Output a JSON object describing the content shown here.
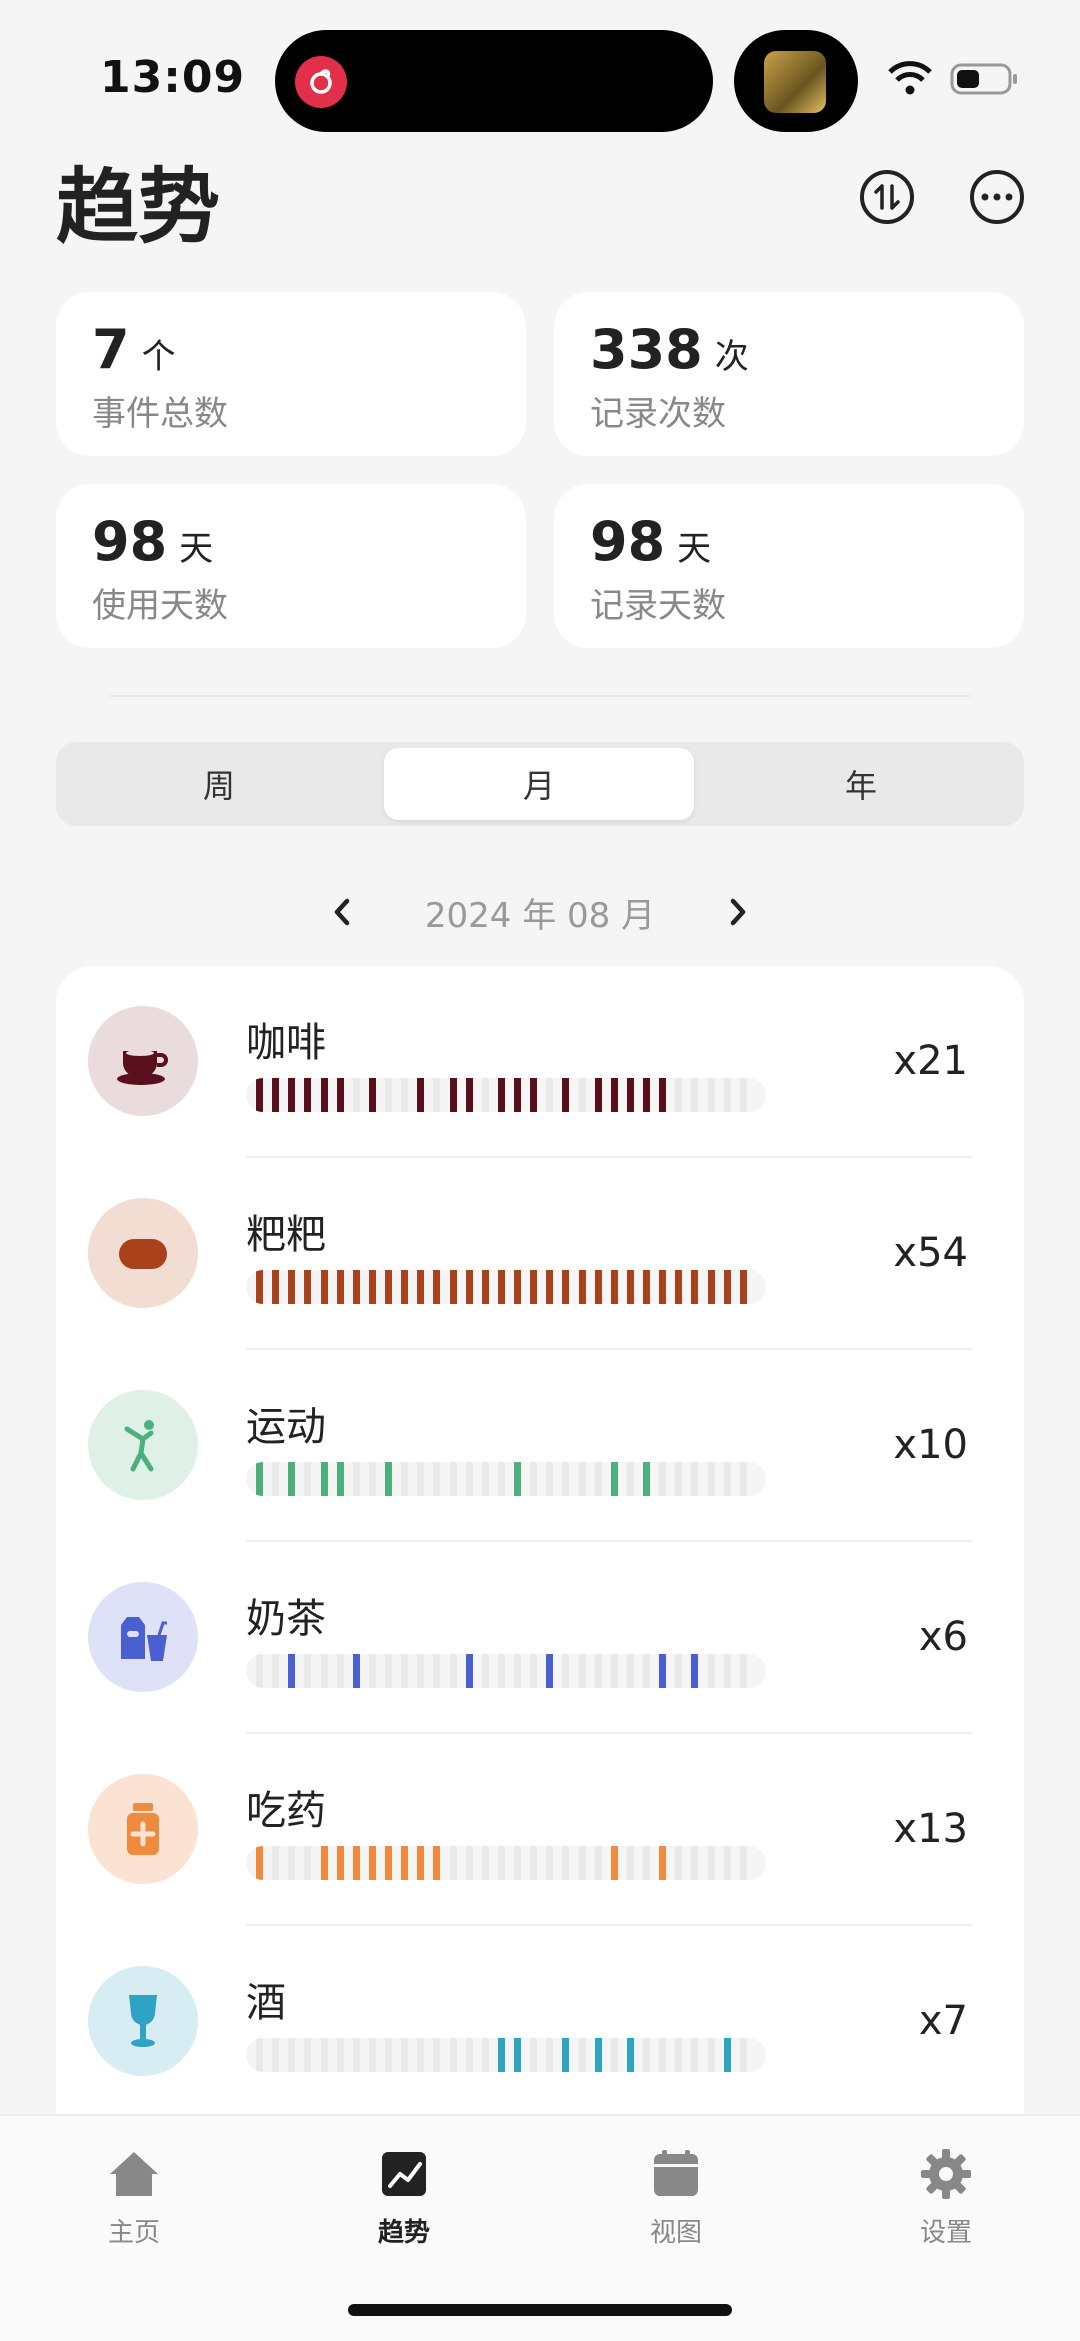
{
  "status": {
    "time": "13:09"
  },
  "header": {
    "title": "趋势"
  },
  "stats": [
    {
      "value": "7",
      "unit": "个",
      "label": "事件总数"
    },
    {
      "value": "338",
      "unit": "次",
      "label": "记录次数"
    },
    {
      "value": "98",
      "unit": "天",
      "label": "使用天数"
    },
    {
      "value": "98",
      "unit": "天",
      "label": "记录天数"
    }
  ],
  "segments": [
    {
      "label": "周"
    },
    {
      "label": "月",
      "active": true
    },
    {
      "label": "年"
    }
  ],
  "period": {
    "label": "2024 年 08 月"
  },
  "colors": {
    "coffee": "#5a0f1c",
    "poop": "#a9421b",
    "sport": "#4caf7d",
    "milktea": "#4a5fd0",
    "medicine": "#f08a3c",
    "wine": "#2ea3c4"
  },
  "events": [
    {
      "name": "咖啡",
      "count": "x21",
      "icon": "coffee-cup-icon",
      "color": "#5a0f1c",
      "icon_bg": "#eadcdc",
      "days": [
        1,
        2,
        3,
        4,
        5,
        6,
        8,
        11,
        13,
        14,
        16,
        17,
        18,
        20,
        22,
        23,
        24,
        25,
        26
      ]
    },
    {
      "name": "粑粑",
      "count": "x54",
      "icon": "poop-icon",
      "color": "#a9421b",
      "icon_bg": "#f1ddd2",
      "days": [
        1,
        2,
        3,
        4,
        5,
        6,
        7,
        8,
        9,
        10,
        11,
        12,
        13,
        14,
        15,
        16,
        17,
        18,
        19,
        20,
        21,
        22,
        23,
        24,
        25,
        26,
        27,
        28,
        29,
        30,
        31
      ]
    },
    {
      "name": "运动",
      "count": "x10",
      "icon": "exercise-icon",
      "color": "#4caf7d",
      "icon_bg": "#dff1e6",
      "days": [
        1,
        3,
        5,
        6,
        9,
        17,
        23,
        25
      ]
    },
    {
      "name": "奶茶",
      "count": "x6",
      "icon": "milk-tea-icon",
      "color": "#4a5fd0",
      "icon_bg": "#dfe2f6",
      "days": [
        3,
        7,
        14,
        19,
        26,
        28
      ]
    },
    {
      "name": "吃药",
      "count": "x13",
      "icon": "medicine-icon",
      "color": "#f08a3c",
      "icon_bg": "#fbe3d3",
      "days": [
        1,
        5,
        6,
        7,
        8,
        9,
        10,
        11,
        12,
        23,
        26
      ]
    },
    {
      "name": "酒",
      "count": "x7",
      "icon": "wine-glass-icon",
      "color": "#2ea3c4",
      "icon_bg": "#d8ecf3",
      "days": [
        16,
        17,
        20,
        22,
        24,
        30
      ]
    }
  ],
  "tabs": [
    {
      "label": "主页",
      "icon": "home-icon"
    },
    {
      "label": "趋势",
      "icon": "trend-chart-icon",
      "active": true
    },
    {
      "label": "视图",
      "icon": "calendar-icon"
    },
    {
      "label": "设置",
      "icon": "gear-icon"
    }
  ]
}
